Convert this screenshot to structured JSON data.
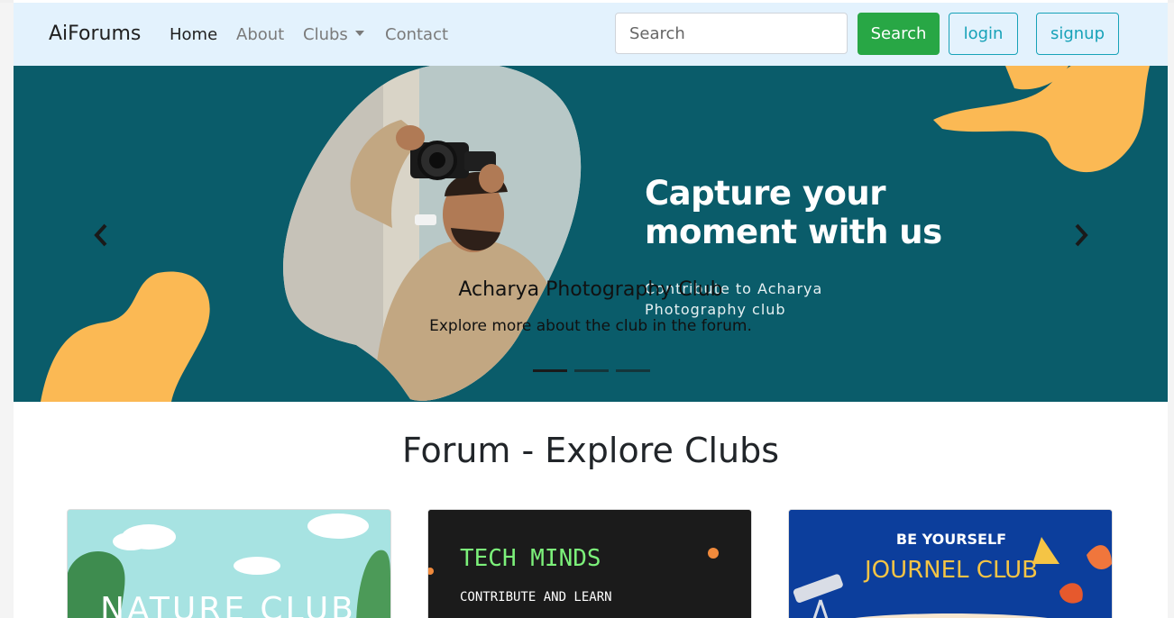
{
  "navbar": {
    "brand": "AiForums",
    "links": [
      {
        "label": "Home",
        "active": true
      },
      {
        "label": "About",
        "active": false
      },
      {
        "label": "Clubs",
        "active": false,
        "dropdown": true
      },
      {
        "label": "Contact",
        "active": false
      }
    ],
    "search_placeholder": "Search",
    "search_button": "Search",
    "login_button": "login",
    "signup_button": "signup"
  },
  "carousel": {
    "headline_line1": "Capture your",
    "headline_line2": "moment with us",
    "subtext_line1": "Contribute to Acharya",
    "subtext_line2": "Photography club",
    "caption_title": "Acharya Photography Club",
    "caption_text": "Explore more about the club in the forum.",
    "slide_count": 3,
    "active_slide": 1,
    "colors": {
      "background": "#0a5c6a",
      "blob": "#fbb954"
    }
  },
  "section": {
    "title": "Forum - Explore Clubs"
  },
  "cards": [
    {
      "image_text": "NATURE CLUB"
    },
    {
      "image_title": "TECH MINDS",
      "image_subtitle": "CONTRIBUTE AND LEARN"
    },
    {
      "image_title": "BE YOURSELF",
      "image_subtitle": "JOURNEL CLUB"
    }
  ]
}
